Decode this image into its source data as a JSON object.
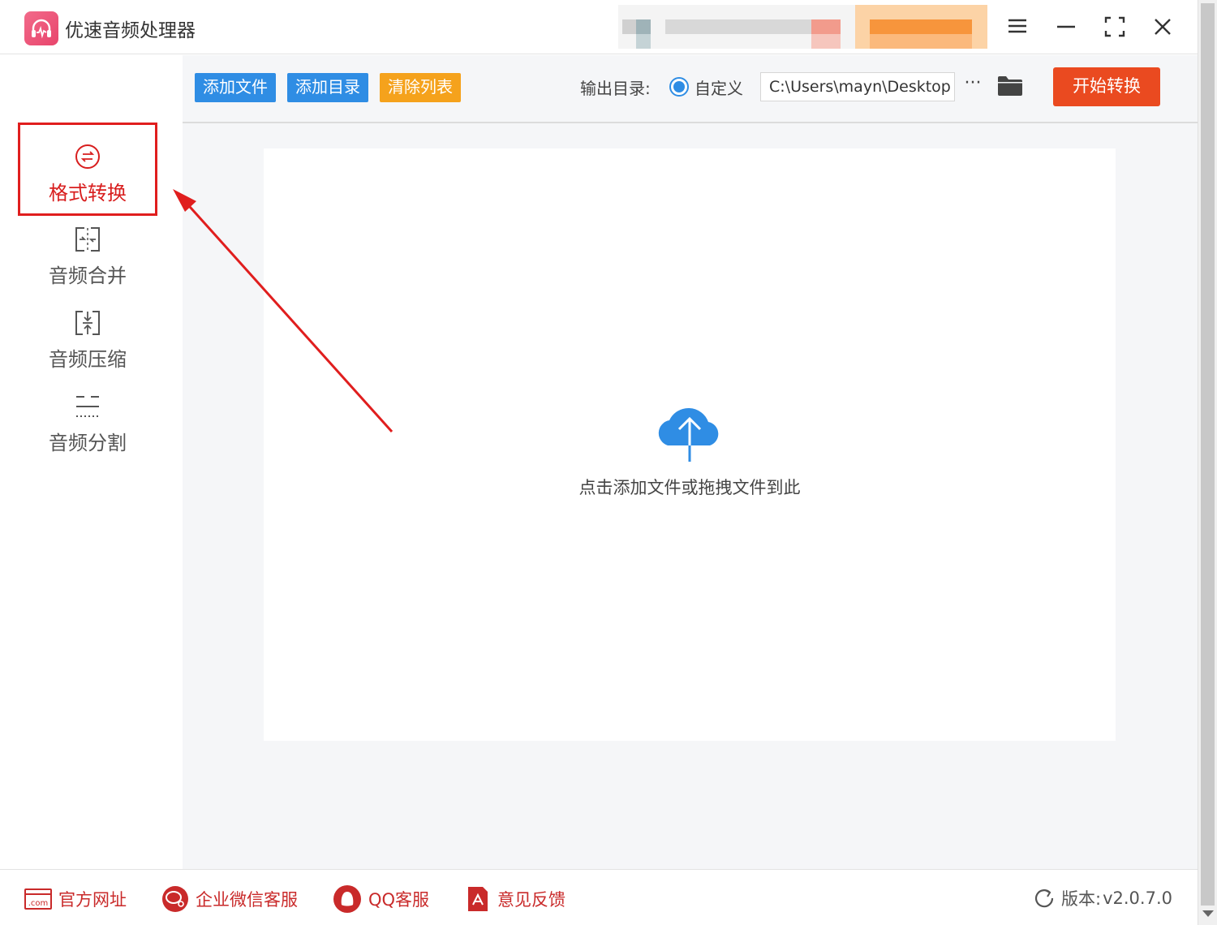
{
  "app": {
    "title": "优速音频处理器",
    "logo_icon": "headphones-wave-icon"
  },
  "window_controls": {
    "menu_icon": "menu-icon",
    "minimize_icon": "minimize-icon",
    "maximize_icon": "fullscreen-icon",
    "close_icon": "close-icon"
  },
  "sidebar": {
    "items": [
      {
        "label": "格式转换",
        "icon": "convert-icon",
        "active": true
      },
      {
        "label": "音频合并",
        "icon": "merge-icon",
        "active": false
      },
      {
        "label": "音频压缩",
        "icon": "compress-icon",
        "active": false
      },
      {
        "label": "音频分割",
        "icon": "split-icon",
        "active": false
      }
    ]
  },
  "toolbar": {
    "add_file": "添加文件",
    "add_folder": "添加目录",
    "clear_list": "清除列表",
    "output_label": "输出目录:",
    "output_mode": "自定义",
    "output_path": "C:\\Users\\mayn\\Desktop",
    "more": "···",
    "folder_icon": "folder-icon",
    "start": "开始转换"
  },
  "dropzone": {
    "icon": "cloud-upload-icon",
    "hint": "点击添加文件或拖拽文件到此"
  },
  "statusbar": {
    "website": "官方网址",
    "wechat": "企业微信客服",
    "qq": "QQ客服",
    "feedback": "意见反馈",
    "version_label": "版本:",
    "version": "v2.0.7.0"
  },
  "colors": {
    "accent_blue": "#2f8de4",
    "accent_orange": "#f5a21c",
    "start_red": "#ea4a20",
    "annotation_red": "#e01e1e"
  }
}
